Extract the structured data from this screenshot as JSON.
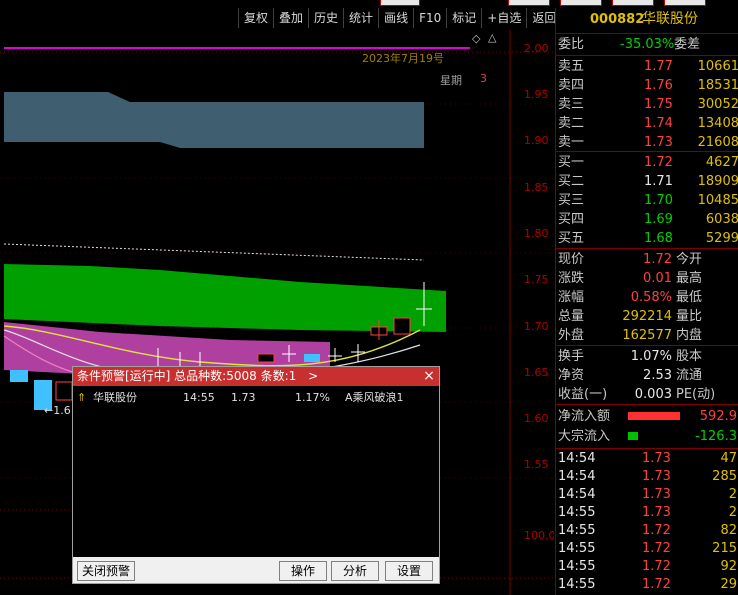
{
  "toolbar": {
    "items": [
      "复权",
      "叠加",
      "历史",
      "统计",
      "画线",
      "F10",
      "标记",
      "+自选",
      "返回"
    ]
  },
  "chart": {
    "date_label": "2023年7月19号",
    "weekday_label": "星期",
    "weekday_value": "3",
    "y_ticks": [
      "2.00",
      "1.95",
      "1.90",
      "1.85",
      "1.80",
      "1.75",
      "1.70",
      "1.65",
      "1.60",
      "1.55"
    ],
    "lower_tick": "100.0",
    "min_marker": "1.6",
    "shift_marker": "◇"
  },
  "quote": {
    "code": "000882",
    "name": "华联股份",
    "ratio_label": "委比",
    "ratio_value": "-35.03%",
    "diff_label": "委差",
    "asks": [
      {
        "label": "卖五",
        "price": "1.77",
        "vol": "10661"
      },
      {
        "label": "卖四",
        "price": "1.76",
        "vol": "18531"
      },
      {
        "label": "卖三",
        "price": "1.75",
        "vol": "30052"
      },
      {
        "label": "卖二",
        "price": "1.74",
        "vol": "13408"
      },
      {
        "label": "卖一",
        "price": "1.73",
        "vol": "21608"
      }
    ],
    "bids": [
      {
        "label": "买一",
        "price": "1.72",
        "vol": "4627"
      },
      {
        "label": "买二",
        "price": "1.71",
        "vol": "18909"
      },
      {
        "label": "买三",
        "price": "1.70",
        "vol": "10485"
      },
      {
        "label": "买四",
        "price": "1.69",
        "vol": "6038"
      },
      {
        "label": "买五",
        "price": "1.68",
        "vol": "5299"
      }
    ],
    "stats": [
      {
        "label": "现价",
        "value": "1.72",
        "label2": "今开"
      },
      {
        "label": "涨跌",
        "value": "0.01",
        "label2": "最高"
      },
      {
        "label": "涨幅",
        "value": "0.58%",
        "label2": "最低"
      },
      {
        "label": "总量",
        "value": "292214",
        "label2": "量比"
      },
      {
        "label": "外盘",
        "value": "162577",
        "label2": "内盘"
      }
    ],
    "stats2": [
      {
        "label": "换手",
        "value": "1.07%",
        "label2": "股本"
      },
      {
        "label": "净资",
        "value": "2.53",
        "label2": "流通"
      },
      {
        "label": "收益(一)",
        "value": "0.003",
        "label2": "PE(动)"
      }
    ],
    "flow": [
      {
        "label": "净流入额",
        "value": "592.9"
      },
      {
        "label": "大宗流入",
        "value": "-126.3"
      }
    ],
    "ticks": [
      {
        "time": "14:54",
        "price": "1.73",
        "vol": "47"
      },
      {
        "time": "14:54",
        "price": "1.73",
        "vol": "285"
      },
      {
        "time": "14:54",
        "price": "1.73",
        "vol": "2"
      },
      {
        "time": "14:55",
        "price": "1.73",
        "vol": "2"
      },
      {
        "time": "14:55",
        "price": "1.72",
        "vol": "82"
      },
      {
        "time": "14:55",
        "price": "1.72",
        "vol": "215"
      },
      {
        "time": "14:55",
        "price": "1.72",
        "vol": "92"
      },
      {
        "time": "14:55",
        "price": "1.72",
        "vol": "29"
      }
    ]
  },
  "dialog": {
    "title": "条件预警[运行中] 总品种数:5008 条数:1",
    "title_arrow": ">",
    "close": "×",
    "row": {
      "name": "华联股份",
      "time": "14:55",
      "price": "1.73",
      "pct": "1.17%",
      "signal": "A乘风破浪1"
    },
    "buttons": {
      "close_alert": "关闭预警",
      "operate": "操作",
      "analyze": "分析",
      "settings": "设置"
    }
  }
}
